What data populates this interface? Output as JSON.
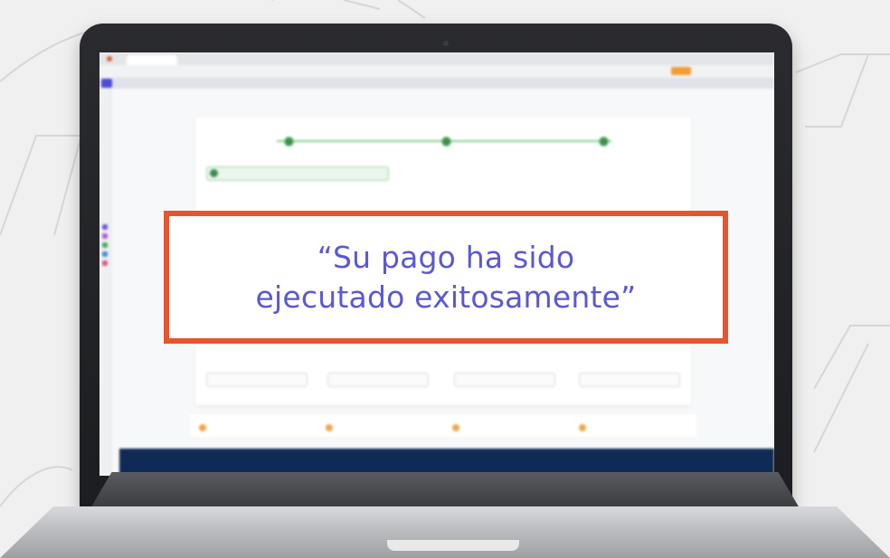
{
  "callout": {
    "line1": "“Su pago ha sido",
    "line2": "ejecutado exitosamente”"
  },
  "colors": {
    "callout_border": "#e8542c",
    "callout_text": "#5b58d4",
    "screen_footer": "#0f2a55",
    "success_green": "#3f8f4f"
  },
  "icons": [
    "laptop-icon",
    "browser-close-icon",
    "success-check-icon",
    "payment-step-icon"
  ]
}
